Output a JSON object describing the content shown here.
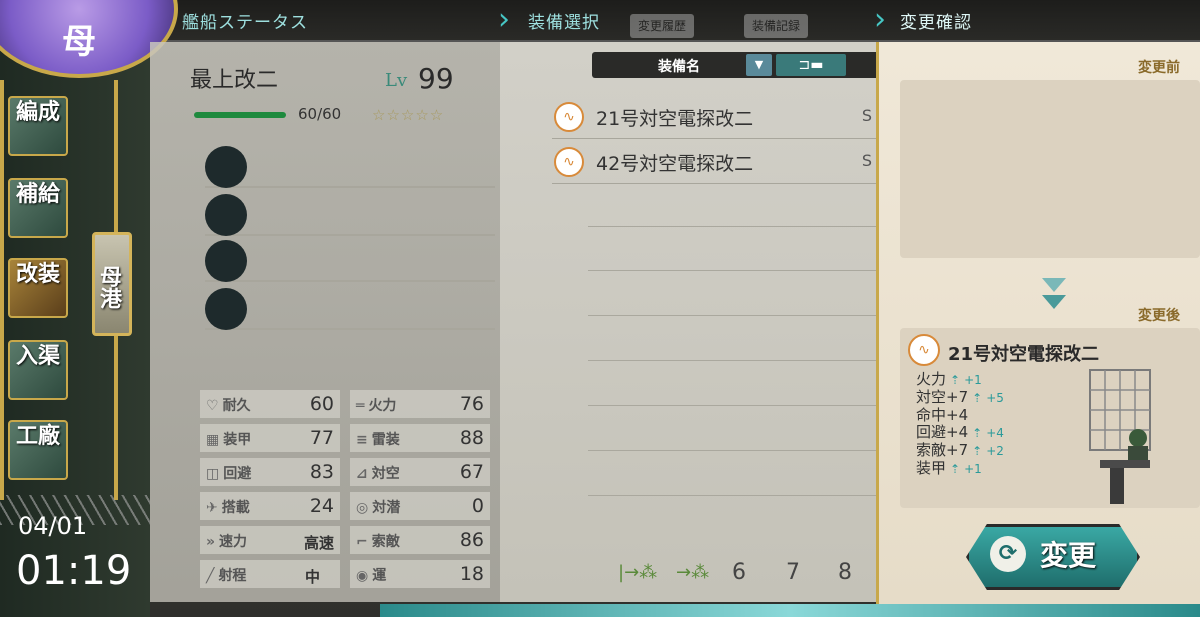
{
  "breadcrumbs": [
    "艦船ステータス",
    "装備選択",
    "変更確認"
  ],
  "ghost_buttons": [
    "変更履歴",
    "装備記録"
  ],
  "emblem_text": "母",
  "sidebar": {
    "items": [
      {
        "label": "編成"
      },
      {
        "label": "補給"
      },
      {
        "label": "改装"
      },
      {
        "label": "入渠"
      },
      {
        "label": "工廠"
      }
    ],
    "port_label": "母港"
  },
  "clock": {
    "date": "04/01",
    "time": "01:19"
  },
  "ship": {
    "name": "最上改二",
    "lv_label": "Lv",
    "level": "99",
    "hp_text": "60/60",
    "hp_fraction": 1.0,
    "stars": "☆☆☆☆☆",
    "stats": [
      {
        "label": "耐久",
        "value": "60"
      },
      {
        "label": "火力",
        "value": "76"
      },
      {
        "label": "装甲",
        "value": "77"
      },
      {
        "label": "雷装",
        "value": "88"
      },
      {
        "label": "回避",
        "value": "83"
      },
      {
        "label": "対空",
        "value": "67"
      },
      {
        "label": "搭載",
        "value": "24"
      },
      {
        "label": "対潜",
        "value": "0"
      },
      {
        "label": "速力",
        "value": "高速"
      },
      {
        "label": "索敵",
        "value": "86"
      },
      {
        "label": "射程",
        "value": "中"
      },
      {
        "label": "運",
        "value": "18"
      }
    ]
  },
  "equipment_list": {
    "header_label": "装備名",
    "sort_icon": "▼",
    "filter_icon": "gun-filter-icon",
    "items": [
      {
        "name": "21号対空電探改二",
        "tail": "S"
      },
      {
        "name": "42号対空電探改二",
        "tail": "S"
      }
    ],
    "pages": [
      "6",
      "7",
      "8"
    ]
  },
  "confirm": {
    "before_label": "変更前",
    "after_label": "変更後",
    "after_item": {
      "name": "21号対空電探改二",
      "stats": [
        {
          "text": "火力",
          "up": "+1"
        },
        {
          "text": "対空+7",
          "up": "+5"
        },
        {
          "text": "命中+4",
          "up": ""
        },
        {
          "text": "回避+4",
          "up": "+4"
        },
        {
          "text": "索敵+7",
          "up": "+2"
        },
        {
          "text": "装甲",
          "up": "+1"
        }
      ]
    },
    "change_button": "変更"
  },
  "colors": {
    "accent": "#46c6c4",
    "gold": "#c8a84a",
    "hp": "#1e8a3e",
    "radar": "#d88a3a"
  }
}
